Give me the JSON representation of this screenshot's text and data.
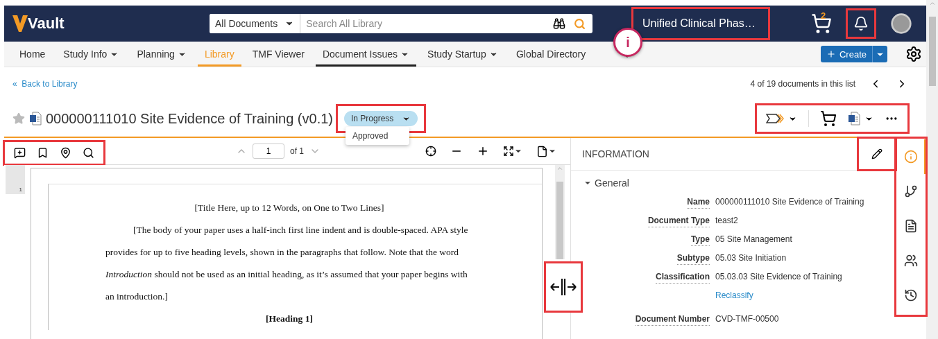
{
  "header": {
    "logo": "Vault",
    "search_scope": "All Documents",
    "search": {
      "placeholder": "Search All Library"
    },
    "site": {
      "label": "Unified Clinical Phas…",
      "highlighted": true
    },
    "cart_count": "2",
    "bell": {
      "highlighted": true
    }
  },
  "callout": {
    "label": "i"
  },
  "nav": [
    {
      "label": "Home",
      "dropdown": false,
      "selected": false,
      "hovered": false
    },
    {
      "label": "Study Info",
      "dropdown": true,
      "selected": false,
      "hovered": false
    },
    {
      "label": "Planning",
      "dropdown": true,
      "selected": false,
      "hovered": false
    },
    {
      "label": "Library",
      "dropdown": false,
      "selected": true,
      "hovered": false
    },
    {
      "label": "TMF Viewer",
      "dropdown": false,
      "selected": false,
      "hovered": false
    },
    {
      "label": "Document Issues",
      "dropdown": true,
      "selected": false,
      "hovered": true
    },
    {
      "label": "Study Startup",
      "dropdown": true,
      "selected": false,
      "hovered": false
    },
    {
      "label": "Global Directory",
      "dropdown": false,
      "selected": false,
      "hovered": false
    }
  ],
  "create_button": "Create",
  "back": {
    "marker": "«",
    "label": "Back to Library"
  },
  "pager": "4 of 19 documents in this list",
  "document": {
    "title": "000000111010 Site Evidence of Training (v0.1)",
    "starred": false,
    "status": {
      "label": "In Progress",
      "highlighted": true,
      "expanded": true,
      "options": [
        "Approved"
      ]
    }
  },
  "actions": {
    "highlighted": true
  },
  "viewer": {
    "tools_highlighted": true,
    "page": "1",
    "page_total": "of 1",
    "thumb_number": "1",
    "handle_highlighted": true,
    "paragraphs": [
      {
        "kind": "title",
        "text": "[Title Here, up to 12 Words, on One to Two Lines]"
      },
      {
        "kind": "body",
        "text": "[The body of your paper uses a half-inch first line indent and is double-spaced.  APA style provides for up to five heading levels, shown in the paragraphs that follow.  Note that the word *Introduction* should not be used as an initial heading, as it’s assumed that your paper begins with an introduction.]"
      },
      {
        "kind": "heading",
        "text": "[Heading 1]"
      }
    ]
  },
  "info": {
    "title": "INFORMATION",
    "edit_highlighted": true,
    "section": {
      "label": "General",
      "expanded": true
    },
    "fields": [
      {
        "kind": "field",
        "label": "Name",
        "value": "000000111010 Site Evidence of Training"
      },
      {
        "kind": "field",
        "label": "Document Type",
        "value": "teast2"
      },
      {
        "kind": "field",
        "label": "Type",
        "value": "05 Site Management"
      },
      {
        "kind": "field",
        "label": "Subtype",
        "value": "05.03 Site Initiation"
      },
      {
        "kind": "field",
        "label": "Classification",
        "value": "05.03.03 Site Evidence of Training"
      },
      {
        "kind": "link",
        "value": "Reclassify"
      },
      {
        "kind": "field",
        "label": "Document Number",
        "value": "CVD-TMF-00500"
      }
    ]
  },
  "side_tabs": {
    "highlighted": true,
    "items": [
      {
        "selected": true
      },
      {
        "selected": false
      },
      {
        "selected": false
      },
      {
        "selected": false
      },
      {
        "selected": false
      }
    ]
  }
}
